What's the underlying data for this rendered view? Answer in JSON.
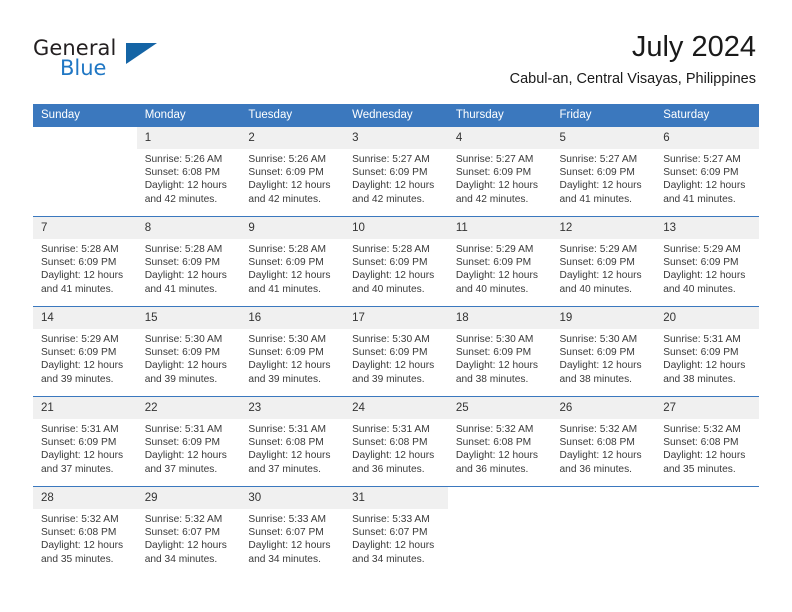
{
  "brand": {
    "name_part1": "General",
    "name_part2": "Blue",
    "triangle_icon": "triangle-logo-icon",
    "accent_color": "#2077c4",
    "triangle_color": "#1464a5"
  },
  "header": {
    "month_year": "July 2024",
    "location": "Cabul-an, Central Visayas, Philippines"
  },
  "calendar": {
    "header_bg": "#3b78be",
    "header_text_color": "#ffffff",
    "daynum_bg": "#f0f0f0",
    "weekdays": [
      "Sunday",
      "Monday",
      "Tuesday",
      "Wednesday",
      "Thursday",
      "Friday",
      "Saturday"
    ],
    "weeks": [
      [
        {
          "day": "",
          "empty": true,
          "sunrise": "",
          "sunset": "",
          "daylight_line1": "",
          "daylight_line2": ""
        },
        {
          "day": "1",
          "sunrise": "Sunrise: 5:26 AM",
          "sunset": "Sunset: 6:08 PM",
          "daylight_line1": "Daylight: 12 hours",
          "daylight_line2": "and 42 minutes."
        },
        {
          "day": "2",
          "sunrise": "Sunrise: 5:26 AM",
          "sunset": "Sunset: 6:09 PM",
          "daylight_line1": "Daylight: 12 hours",
          "daylight_line2": "and 42 minutes."
        },
        {
          "day": "3",
          "sunrise": "Sunrise: 5:27 AM",
          "sunset": "Sunset: 6:09 PM",
          "daylight_line1": "Daylight: 12 hours",
          "daylight_line2": "and 42 minutes."
        },
        {
          "day": "4",
          "sunrise": "Sunrise: 5:27 AM",
          "sunset": "Sunset: 6:09 PM",
          "daylight_line1": "Daylight: 12 hours",
          "daylight_line2": "and 42 minutes."
        },
        {
          "day": "5",
          "sunrise": "Sunrise: 5:27 AM",
          "sunset": "Sunset: 6:09 PM",
          "daylight_line1": "Daylight: 12 hours",
          "daylight_line2": "and 41 minutes."
        },
        {
          "day": "6",
          "sunrise": "Sunrise: 5:27 AM",
          "sunset": "Sunset: 6:09 PM",
          "daylight_line1": "Daylight: 12 hours",
          "daylight_line2": "and 41 minutes."
        }
      ],
      [
        {
          "day": "7",
          "sunrise": "Sunrise: 5:28 AM",
          "sunset": "Sunset: 6:09 PM",
          "daylight_line1": "Daylight: 12 hours",
          "daylight_line2": "and 41 minutes."
        },
        {
          "day": "8",
          "sunrise": "Sunrise: 5:28 AM",
          "sunset": "Sunset: 6:09 PM",
          "daylight_line1": "Daylight: 12 hours",
          "daylight_line2": "and 41 minutes."
        },
        {
          "day": "9",
          "sunrise": "Sunrise: 5:28 AM",
          "sunset": "Sunset: 6:09 PM",
          "daylight_line1": "Daylight: 12 hours",
          "daylight_line2": "and 41 minutes."
        },
        {
          "day": "10",
          "sunrise": "Sunrise: 5:28 AM",
          "sunset": "Sunset: 6:09 PM",
          "daylight_line1": "Daylight: 12 hours",
          "daylight_line2": "and 40 minutes."
        },
        {
          "day": "11",
          "sunrise": "Sunrise: 5:29 AM",
          "sunset": "Sunset: 6:09 PM",
          "daylight_line1": "Daylight: 12 hours",
          "daylight_line2": "and 40 minutes."
        },
        {
          "day": "12",
          "sunrise": "Sunrise: 5:29 AM",
          "sunset": "Sunset: 6:09 PM",
          "daylight_line1": "Daylight: 12 hours",
          "daylight_line2": "and 40 minutes."
        },
        {
          "day": "13",
          "sunrise": "Sunrise: 5:29 AM",
          "sunset": "Sunset: 6:09 PM",
          "daylight_line1": "Daylight: 12 hours",
          "daylight_line2": "and 40 minutes."
        }
      ],
      [
        {
          "day": "14",
          "sunrise": "Sunrise: 5:29 AM",
          "sunset": "Sunset: 6:09 PM",
          "daylight_line1": "Daylight: 12 hours",
          "daylight_line2": "and 39 minutes."
        },
        {
          "day": "15",
          "sunrise": "Sunrise: 5:30 AM",
          "sunset": "Sunset: 6:09 PM",
          "daylight_line1": "Daylight: 12 hours",
          "daylight_line2": "and 39 minutes."
        },
        {
          "day": "16",
          "sunrise": "Sunrise: 5:30 AM",
          "sunset": "Sunset: 6:09 PM",
          "daylight_line1": "Daylight: 12 hours",
          "daylight_line2": "and 39 minutes."
        },
        {
          "day": "17",
          "sunrise": "Sunrise: 5:30 AM",
          "sunset": "Sunset: 6:09 PM",
          "daylight_line1": "Daylight: 12 hours",
          "daylight_line2": "and 39 minutes."
        },
        {
          "day": "18",
          "sunrise": "Sunrise: 5:30 AM",
          "sunset": "Sunset: 6:09 PM",
          "daylight_line1": "Daylight: 12 hours",
          "daylight_line2": "and 38 minutes."
        },
        {
          "day": "19",
          "sunrise": "Sunrise: 5:30 AM",
          "sunset": "Sunset: 6:09 PM",
          "daylight_line1": "Daylight: 12 hours",
          "daylight_line2": "and 38 minutes."
        },
        {
          "day": "20",
          "sunrise": "Sunrise: 5:31 AM",
          "sunset": "Sunset: 6:09 PM",
          "daylight_line1": "Daylight: 12 hours",
          "daylight_line2": "and 38 minutes."
        }
      ],
      [
        {
          "day": "21",
          "sunrise": "Sunrise: 5:31 AM",
          "sunset": "Sunset: 6:09 PM",
          "daylight_line1": "Daylight: 12 hours",
          "daylight_line2": "and 37 minutes."
        },
        {
          "day": "22",
          "sunrise": "Sunrise: 5:31 AM",
          "sunset": "Sunset: 6:09 PM",
          "daylight_line1": "Daylight: 12 hours",
          "daylight_line2": "and 37 minutes."
        },
        {
          "day": "23",
          "sunrise": "Sunrise: 5:31 AM",
          "sunset": "Sunset: 6:08 PM",
          "daylight_line1": "Daylight: 12 hours",
          "daylight_line2": "and 37 minutes."
        },
        {
          "day": "24",
          "sunrise": "Sunrise: 5:31 AM",
          "sunset": "Sunset: 6:08 PM",
          "daylight_line1": "Daylight: 12 hours",
          "daylight_line2": "and 36 minutes."
        },
        {
          "day": "25",
          "sunrise": "Sunrise: 5:32 AM",
          "sunset": "Sunset: 6:08 PM",
          "daylight_line1": "Daylight: 12 hours",
          "daylight_line2": "and 36 minutes."
        },
        {
          "day": "26",
          "sunrise": "Sunrise: 5:32 AM",
          "sunset": "Sunset: 6:08 PM",
          "daylight_line1": "Daylight: 12 hours",
          "daylight_line2": "and 36 minutes."
        },
        {
          "day": "27",
          "sunrise": "Sunrise: 5:32 AM",
          "sunset": "Sunset: 6:08 PM",
          "daylight_line1": "Daylight: 12 hours",
          "daylight_line2": "and 35 minutes."
        }
      ],
      [
        {
          "day": "28",
          "sunrise": "Sunrise: 5:32 AM",
          "sunset": "Sunset: 6:08 PM",
          "daylight_line1": "Daylight: 12 hours",
          "daylight_line2": "and 35 minutes."
        },
        {
          "day": "29",
          "sunrise": "Sunrise: 5:32 AM",
          "sunset": "Sunset: 6:07 PM",
          "daylight_line1": "Daylight: 12 hours",
          "daylight_line2": "and 34 minutes."
        },
        {
          "day": "30",
          "sunrise": "Sunrise: 5:33 AM",
          "sunset": "Sunset: 6:07 PM",
          "daylight_line1": "Daylight: 12 hours",
          "daylight_line2": "and 34 minutes."
        },
        {
          "day": "31",
          "sunrise": "Sunrise: 5:33 AM",
          "sunset": "Sunset: 6:07 PM",
          "daylight_line1": "Daylight: 12 hours",
          "daylight_line2": "and 34 minutes."
        },
        {
          "day": "",
          "empty": true,
          "sunrise": "",
          "sunset": "",
          "daylight_line1": "",
          "daylight_line2": ""
        },
        {
          "day": "",
          "empty": true,
          "sunrise": "",
          "sunset": "",
          "daylight_line1": "",
          "daylight_line2": ""
        },
        {
          "day": "",
          "empty": true,
          "sunrise": "",
          "sunset": "",
          "daylight_line1": "",
          "daylight_line2": ""
        }
      ]
    ]
  }
}
